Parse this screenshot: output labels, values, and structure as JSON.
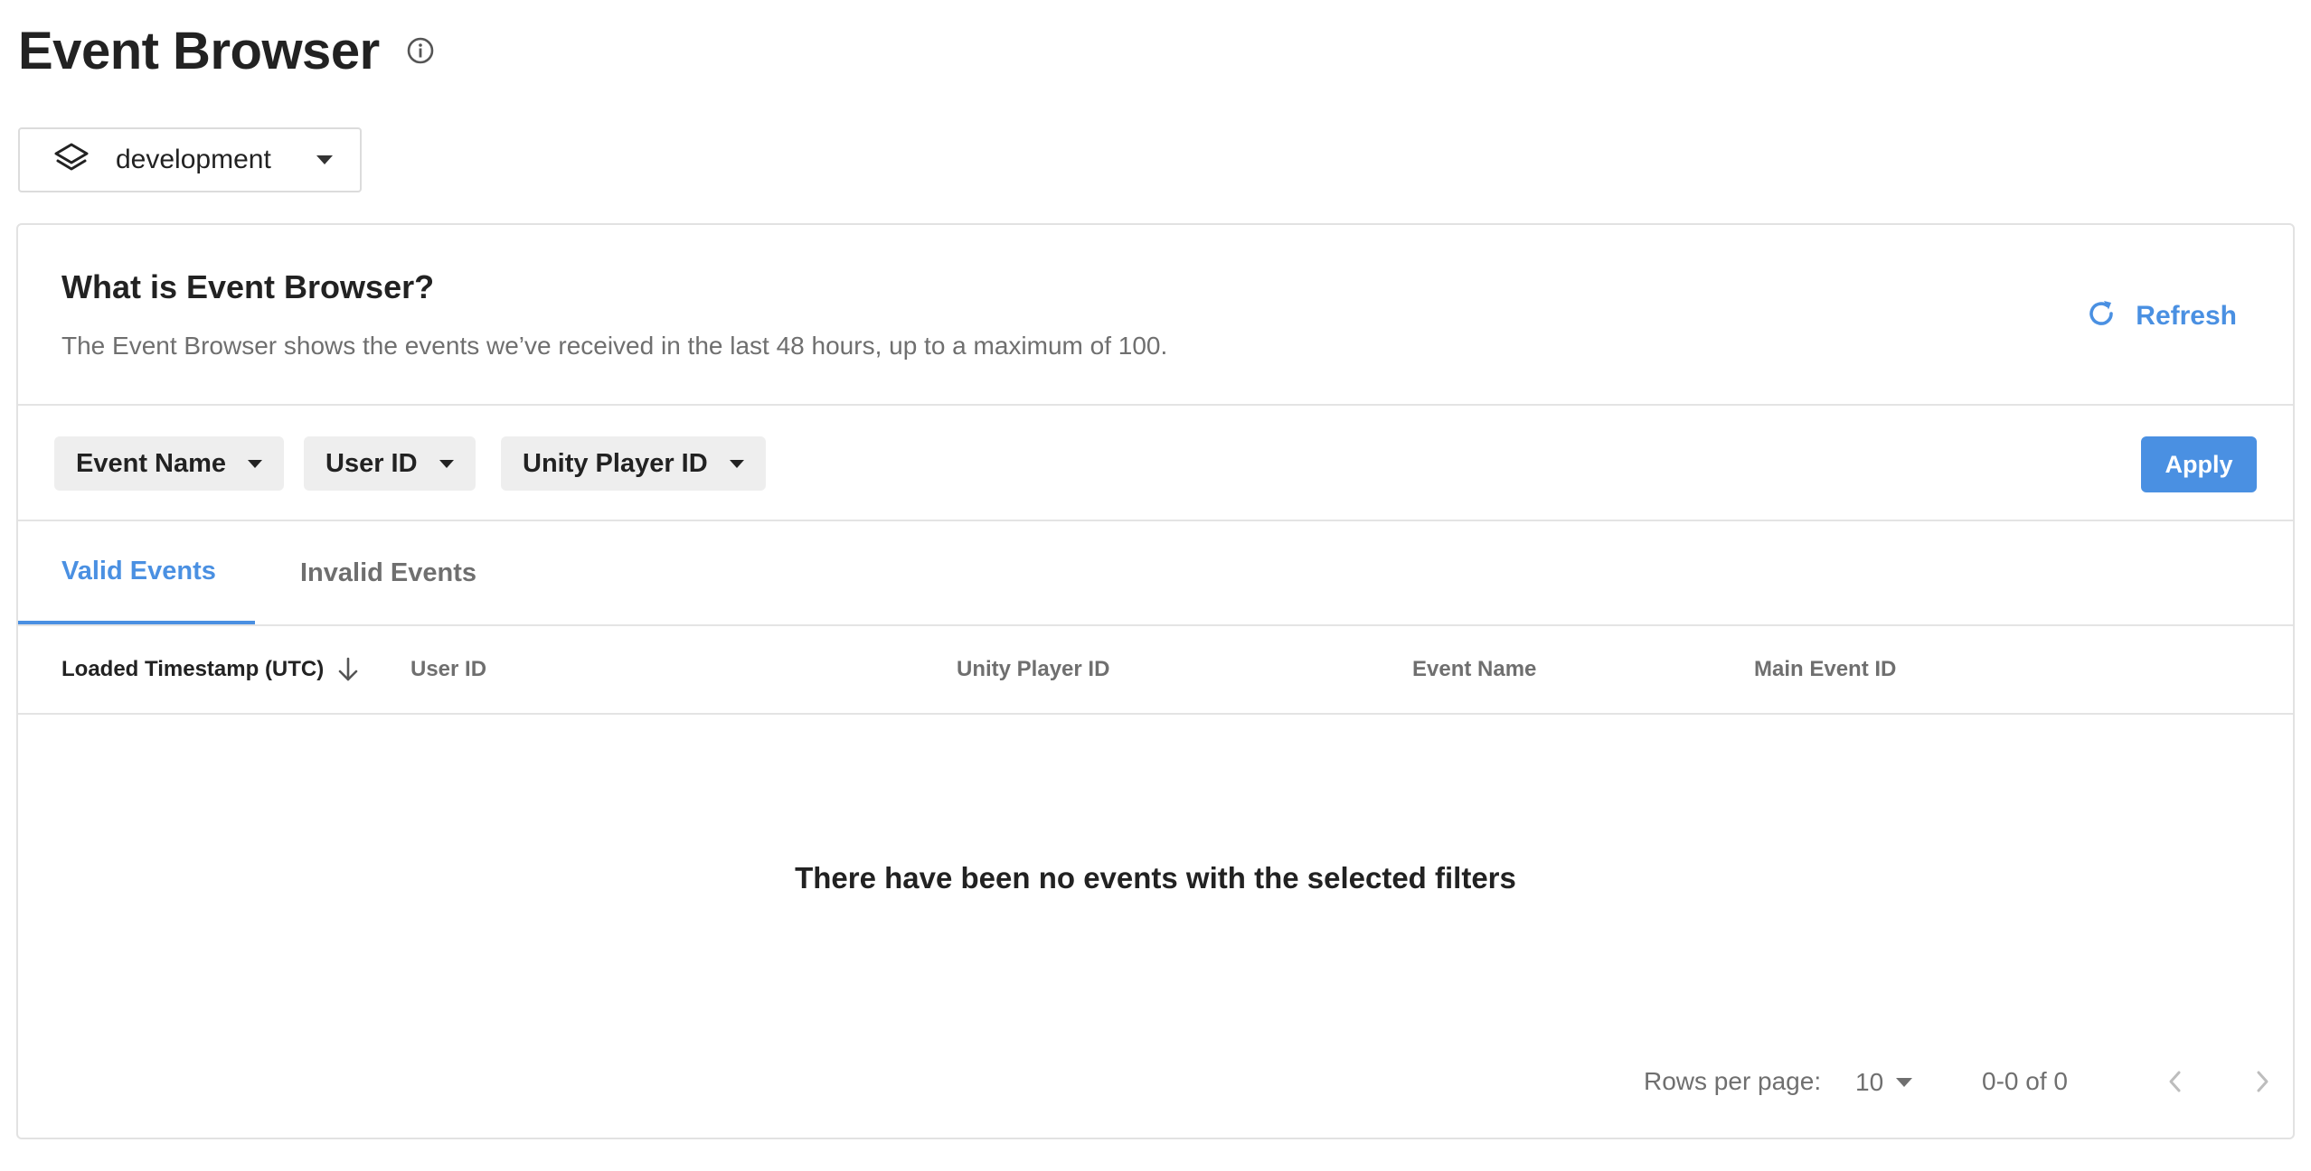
{
  "page": {
    "title": "Event Browser"
  },
  "icons": {
    "info": "info-icon",
    "layers": "layers-icon",
    "refresh": "refresh-icon",
    "sort": "arrow-down-icon",
    "prev": "chevron-left-icon",
    "next": "chevron-right-icon"
  },
  "environment": {
    "selected": "development"
  },
  "intro": {
    "title": "What is Event Browser?",
    "description": "The Event Browser shows the events we’ve received in the last 48 hours, up to a maximum of 100.",
    "refresh_label": "Refresh"
  },
  "filters": {
    "items": [
      {
        "label": "Event Name"
      },
      {
        "label": "User ID"
      },
      {
        "label": "Unity Player ID"
      }
    ],
    "apply_label": "Apply"
  },
  "tabs": [
    {
      "label": "Valid Events",
      "active": true
    },
    {
      "label": "Invalid Events",
      "active": false
    }
  ],
  "table": {
    "columns": [
      {
        "label": "Loaded Timestamp (UTC)",
        "sorted": "desc"
      },
      {
        "label": "User ID"
      },
      {
        "label": "Unity Player ID"
      },
      {
        "label": "Event Name"
      },
      {
        "label": "Main Event ID"
      }
    ],
    "rows": [],
    "empty_message": "There have been no events with the selected filters"
  },
  "pagination": {
    "rows_per_page_label": "Rows per page:",
    "rows_per_page": "10",
    "range": "0-0 of 0"
  },
  "colors": {
    "accent": "#4a90e2",
    "text_primary": "#222222",
    "text_secondary": "#6f6f6f",
    "border": "#e2e2e2",
    "chip_bg": "#eeeeee"
  }
}
